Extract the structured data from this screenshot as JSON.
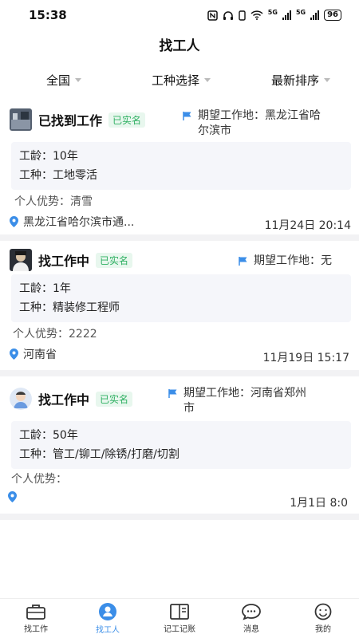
{
  "status": {
    "time": "15:38",
    "net1": "5G",
    "net2": "5G",
    "battery": "96"
  },
  "header": {
    "title": "找工人"
  },
  "filters": [
    {
      "label": "全国"
    },
    {
      "label": "工种选择"
    },
    {
      "label": "最新排序"
    }
  ],
  "colors": {
    "accent": "#3b8ee8",
    "badge_text": "#2fb062",
    "badge_bg": "#e8f7ee",
    "list_bg": "#f2f2f4"
  },
  "workers": [
    {
      "name": "已找到工作",
      "badge": "已实名",
      "expect_line1": "期望工作地：黑龙江省哈",
      "expect_line2": "尔滨市",
      "experience": "工龄：10年",
      "trade": "工种：工地零活",
      "advantage": "个人优势：清雪",
      "location": "黑龙江省哈尔滨市通...",
      "time": "11月24日 20:14"
    },
    {
      "name": "找工作中",
      "badge": "已实名",
      "expect_line1": "期望工作地：无",
      "experience": "工龄：1年",
      "trade": "工种：精装修工程师",
      "advantage": "个人优势：2222",
      "location": "河南省",
      "time": "11月19日 15:17"
    },
    {
      "name": "找工作中",
      "badge": "已实名",
      "expect_line1": "期望工作地：河南省郑州",
      "expect_line2": "市",
      "experience": "工龄：50年",
      "trade": "工种：管工/铆工/除锈/打磨/切割",
      "advantage": "个人优势：",
      "location": "",
      "time": "1月1日 8:0"
    }
  ],
  "tabs": [
    {
      "label": "找工作",
      "icon": "briefcase-icon"
    },
    {
      "label": "找工人",
      "icon": "worker-icon",
      "active": true
    },
    {
      "label": "记工记账",
      "icon": "ledger-icon"
    },
    {
      "label": "消息",
      "icon": "message-icon"
    },
    {
      "label": "我的",
      "icon": "profile-icon"
    }
  ]
}
